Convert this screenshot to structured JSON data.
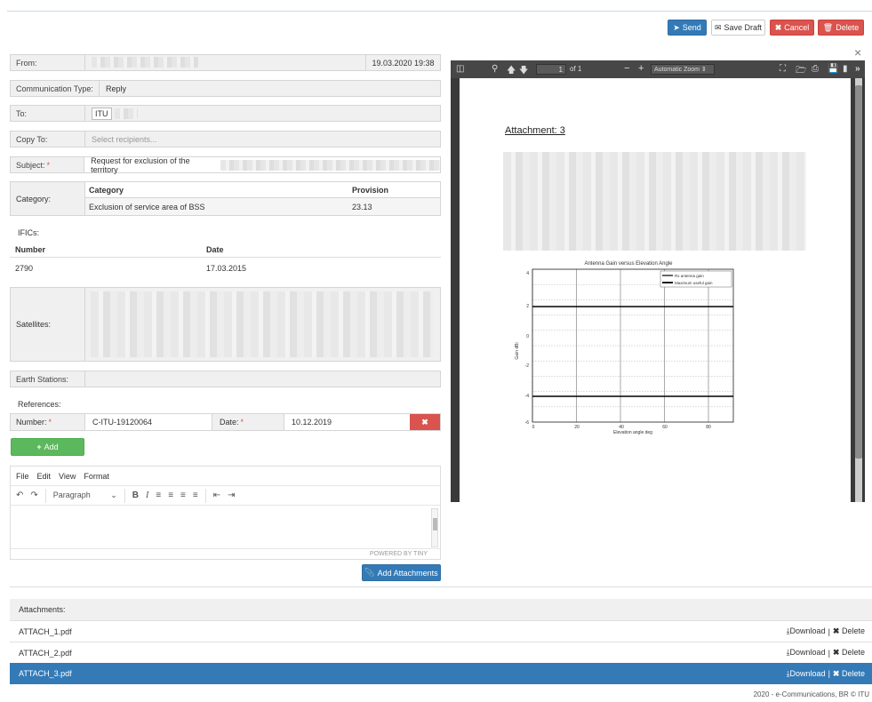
{
  "toolbar": {
    "send": "Send",
    "save_draft": "Save Draft",
    "cancel": "Cancel",
    "delete": "Delete"
  },
  "form": {
    "from_label": "From:",
    "from_date": "19.03.2020 19:38",
    "comm_type_label": "Communication Type:",
    "comm_type_value": "Reply",
    "to_label": "To:",
    "to_value": "ITU",
    "copy_to_label": "Copy To:",
    "copy_to_placeholder": "Select recipients...",
    "subject_label": "Subject:",
    "subject_value": "Request for exclusion of the territory",
    "category_label": "Category:",
    "category_headers": [
      "Category",
      "Provision"
    ],
    "category_row": [
      "Exclusion of service area of BSS",
      "23.13"
    ],
    "ific_label": "IFICs:",
    "ific_headers": [
      "Number",
      "Date"
    ],
    "ific_row": [
      "2790",
      "17.03.2015"
    ],
    "satellites_label": "Satellites:",
    "earth_stations_label": "Earth Stations:",
    "references_label": "References:",
    "ref_number_label": "Number:",
    "ref_number_value": "C-ITU-19120064",
    "ref_date_label": "Date:",
    "ref_date_value": "10.12.2019",
    "add_button": "Add"
  },
  "editor": {
    "menu": [
      "File",
      "Edit",
      "View",
      "Format"
    ],
    "block_format": "Paragraph",
    "powered_by": "POWERED BY TINY"
  },
  "add_attachments": "Add Attachments",
  "pdf": {
    "page_input": "1",
    "page_total": "of 1",
    "zoom": "Automatic Zoom",
    "attachment_title": "Attachment: 3",
    "chart_title": "Antenna Gain versus Elevation Angle",
    "legend": [
      "Rx antenna gain",
      "Maximum useful gain"
    ],
    "x_ticks": [
      "0",
      "20",
      "40",
      "60",
      "80"
    ],
    "y_ticks": [
      "4",
      "2",
      "0",
      "-2",
      "-4",
      "-6"
    ],
    "x_label": "Elevation angle deg",
    "y_label": "Gain dBi"
  },
  "attachments": {
    "header": "Attachments:",
    "download": "Download",
    "delete": "Delete",
    "separator": "|",
    "items": [
      "ATTACH_1.pdf",
      "ATTACH_2.pdf",
      "ATTACH_3.pdf"
    ]
  },
  "footer": "2020 - e-Communications, BR © ITU",
  "close_glyph": "×",
  "colors": {
    "primary": "#337ab7",
    "danger": "#d9534f",
    "success": "#5cb85c",
    "selected_row": "#337ab7"
  }
}
